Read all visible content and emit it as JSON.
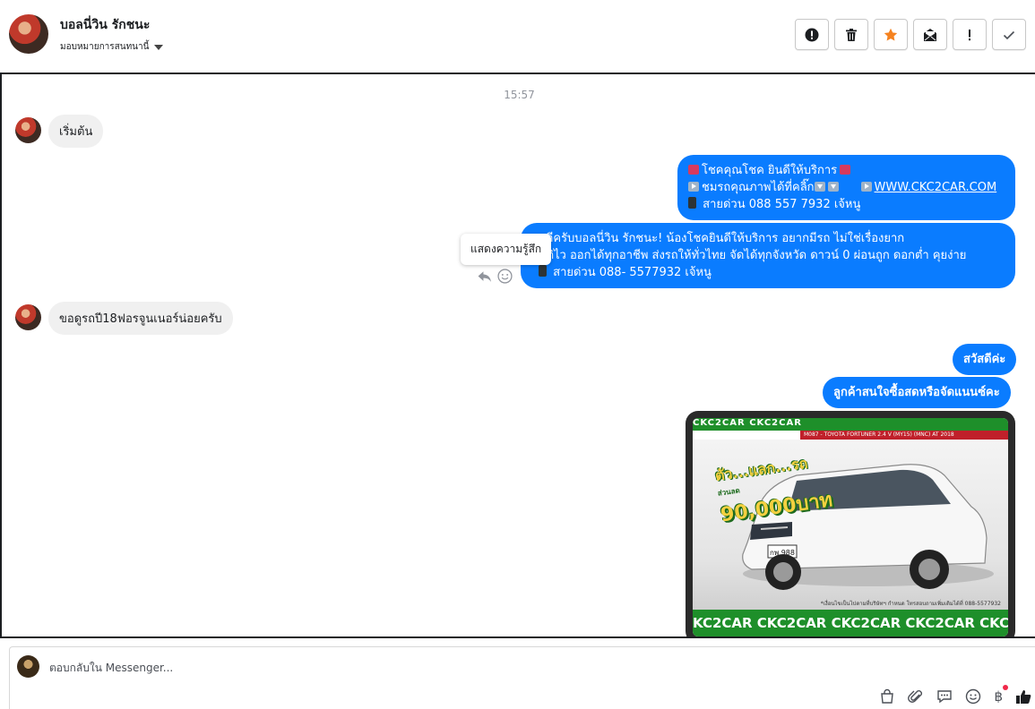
{
  "header": {
    "contact_name": "บอลนี่วิน รักชนะ",
    "assign_label": "มอบหมายการสนทนานี้",
    "buttons": [
      {
        "name": "spam-button",
        "icon": "exclamation-circle-icon"
      },
      {
        "name": "delete-button",
        "icon": "trash-icon"
      },
      {
        "name": "star-button",
        "icon": "star-icon",
        "color": "#f5821f"
      },
      {
        "name": "mark-unread-button",
        "icon": "envelope-icon"
      },
      {
        "name": "follow-up-button",
        "icon": "exclamation-icon"
      },
      {
        "name": "done-button",
        "icon": "check-icon"
      }
    ]
  },
  "conversation": {
    "timestamp": "15:57",
    "msg_start": "เริ่มต้น",
    "msg_promo": {
      "line1": "โชคคุณโชค ยินดีให้บริการ",
      "line2": "ชมรถคุณภาพได้ที่คลิ๊ก",
      "link": "WWW.CKC2CAR.COM",
      "line3": "สายด่วน 088 557 7932 เจ้หนู"
    },
    "msg_welcome": {
      "line1": "สดีครับบอลนี่วิน รักชนะ! น้องโชคยินดีให้บริการ อยากมีรถ ไม่ใช่เรื่องยาก",
      "line2": "มัติไว ออกได้ทุกอาชีพ ส่งรถให้ทั่วไทย จัดได้ทุกจังหวัด ดาวน์ 0  ผ่อนถูก ดอกต่ำ คุยง่าย",
      "line3": "สายด่วน 088- 5577932 เจ้หนู"
    },
    "tooltip": "แสดงความรู้สึก",
    "msg_customer": "ขอดูรถปี18ฟอรจูนเนอร์น่อยครับ",
    "msg_hello": "สวัสดีค่ะ",
    "msg_question": "ลูกค้าสนใจซื้อสดหรือจัดแนนซ์คะ",
    "car_image": {
      "top_strip": "CKC2CAR CKC2CAR",
      "model": "M087 - TOYOTA FORTUNER 2.4 V (MY15) (MNC) AT 2018",
      "promo_line1": "ตัว...แลก...รถ",
      "promo_small": "ส่วนลด",
      "promo_line2": "90,000บาท",
      "phone_note": "*เงื่อนไขเป็นไปตามที่บริษัทฯ กำหนด โทรสอบถามเพิ่มเติมได้ที่ 088-5577932",
      "bottom_strip": "KC2CAR CKC2CAR CKC2CAR CKC2CAR CKC2CAR CKC2"
    }
  },
  "reply": {
    "placeholder": "ตอบกลับใน Messenger..."
  }
}
